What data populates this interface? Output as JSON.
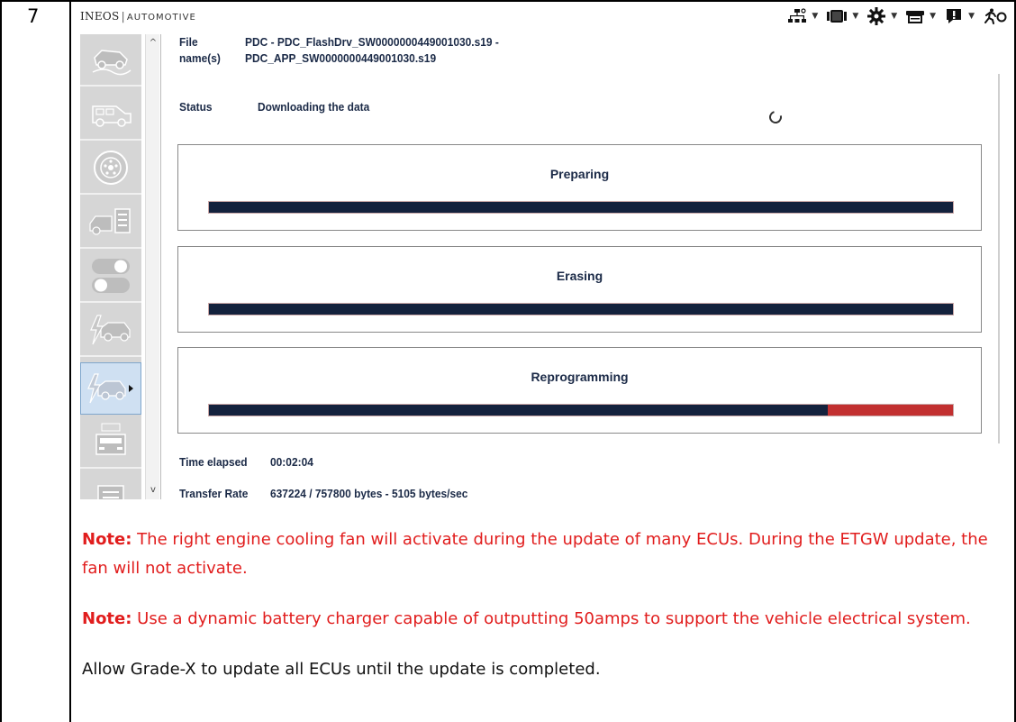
{
  "step": {
    "number": "7"
  },
  "app": {
    "brand": {
      "name": "INEOS",
      "separator": "|",
      "sub": "AUTOMOTIVE"
    },
    "toolbar": [
      {
        "icon": "network-icon"
      },
      {
        "icon": "vehicle-ecu-icon"
      },
      {
        "icon": "gear-icon"
      },
      {
        "icon": "printer-icon"
      },
      {
        "icon": "info-icon"
      },
      {
        "icon": "exit-runner-icon"
      }
    ],
    "sidebar": [
      {
        "icon": "offroad-vehicle-icon",
        "active": false
      },
      {
        "icon": "vehicle-side-icon",
        "active": false
      },
      {
        "icon": "wheel-icon",
        "active": false
      },
      {
        "icon": "vehicle-checklist-icon",
        "active": false
      },
      {
        "icon": "toggle-switch-icon",
        "active": false
      },
      {
        "icon": "vehicle-flash-icon",
        "active": false
      },
      {
        "icon": "vehicle-flash-programming-icon",
        "active": true
      },
      {
        "icon": "vehicle-front-icon",
        "active": false
      },
      {
        "icon": "document-icon",
        "active": false
      }
    ],
    "file": {
      "label_line1": "File",
      "label_line2": "name(s)",
      "value_line1": "PDC - PDC_FlashDrv_SW0000000449001030.s19 -",
      "value_line2": "PDC_APP_SW0000000449001030.s19"
    },
    "status": {
      "label": "Status",
      "value": "Downloading the data"
    },
    "progress": [
      {
        "title": "Preparing",
        "fraction": 1.0
      },
      {
        "title": "Erasing",
        "fraction": 1.0
      },
      {
        "title": "Reprogramming",
        "fraction": 0.832
      }
    ],
    "time_elapsed": {
      "label": "Time elapsed",
      "value": "00:02:04"
    },
    "transfer_rate": {
      "label": "Transfer Rate",
      "value": "637224 / 757800 bytes - 5105 bytes/sec"
    }
  },
  "notes": [
    {
      "prefix": "Note:",
      "text": " The right engine cooling fan will activate during the update of many ECUs. During the ETGW update, the fan will not activate."
    },
    {
      "prefix": "Note:",
      "text": " Use a dynamic battery charger capable of outputting 50amps to support the vehicle electrical system."
    }
  ],
  "instruction": "Allow Grade-X to update all ECUs until the update is completed.",
  "colors": {
    "note_red": "#e11d1d",
    "bar_fill": "#14223d",
    "bar_remaining": "#c23030",
    "label_navy": "#1b2a47",
    "active_item": "#cfe0f2"
  }
}
